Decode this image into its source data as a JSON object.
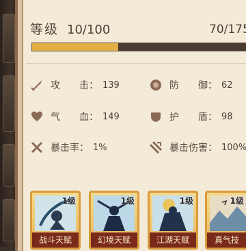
{
  "level": {
    "label": "等级",
    "value": "10/100"
  },
  "exp": {
    "value": "70/175",
    "progress": 0.4
  },
  "stats": [
    {
      "icon": "sword-icon",
      "label": "攻　　击：",
      "value": "139"
    },
    {
      "icon": "shield-icon",
      "label": "防　　御：",
      "value": "62"
    },
    {
      "icon": "heart-icon",
      "label": "气　　血：",
      "value": "149"
    },
    {
      "icon": "armor-icon",
      "label": "护　　盾：",
      "value": "98"
    },
    {
      "icon": "crossed-swords-icon",
      "label": "暴击率：",
      "value": "1%"
    },
    {
      "icon": "crit-damage-icon",
      "label": "暴击伤害：",
      "value": "100%"
    }
  ],
  "talents": [
    {
      "name": "战斗天赋",
      "level": "1级"
    },
    {
      "name": "幻境天赋",
      "level": "1级"
    },
    {
      "name": "江湖天赋",
      "level": "1级"
    },
    {
      "name": "真气技",
      "level": "1级"
    }
  ],
  "colors": {
    "exp_fill": "#e2ad45",
    "card_border": "#d89b3c",
    "card_label_bg": "#7a2a1a"
  }
}
